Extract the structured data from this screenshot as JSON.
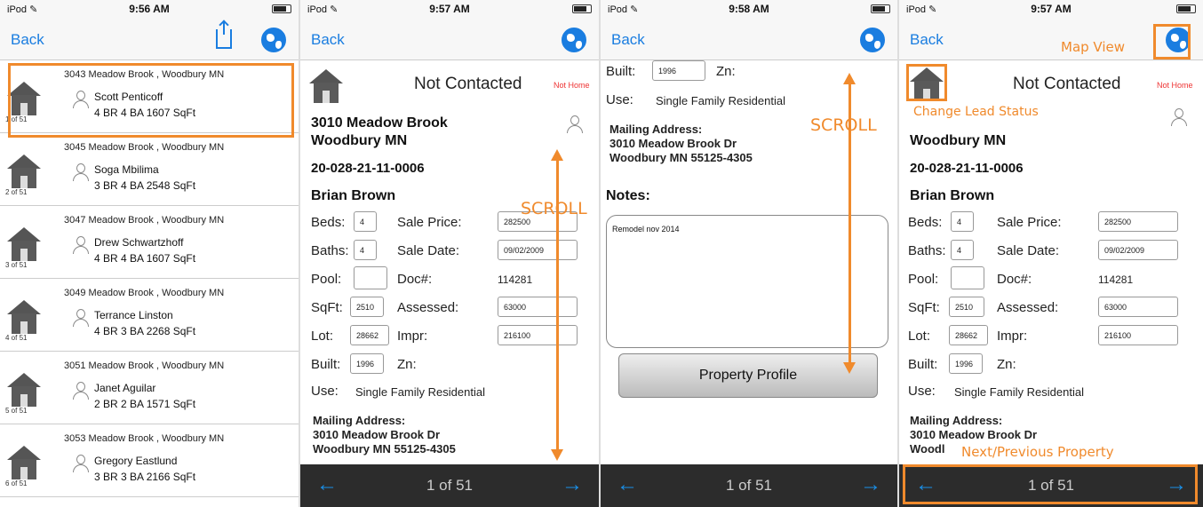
{
  "status_bar": [
    {
      "device": "iPod ✎",
      "time": "9:56 AM"
    },
    {
      "device": "iPod ✎",
      "time": "9:57 AM"
    },
    {
      "device": "iPod ✎",
      "time": "9:58 AM"
    },
    {
      "device": "iPod ✎",
      "time": "9:57 AM"
    }
  ],
  "back_label": "Back",
  "list": [
    {
      "address": "3043 Meadow Brook , Woodbury MN",
      "name": "Scott Penticoff",
      "specs": "4 BR  4 BA  1607 SqFt",
      "count": "1 of 51"
    },
    {
      "address": "3045 Meadow Brook , Woodbury MN",
      "name": "Soga Mbilima",
      "specs": "3 BR  4 BA  2548 SqFt",
      "count": "2 of 51"
    },
    {
      "address": "3047 Meadow Brook , Woodbury MN",
      "name": "Drew Schwartzhoff",
      "specs": "4 BR  4 BA  1607 SqFt",
      "count": "3 of 51"
    },
    {
      "address": "3049 Meadow Brook , Woodbury MN",
      "name": "Terrance Linston",
      "specs": "4 BR  3 BA  2268 SqFt",
      "count": "4 of 51"
    },
    {
      "address": "3051 Meadow Brook , Woodbury MN",
      "name": "Janet Aguilar",
      "specs": "2 BR  2 BA  1571 SqFt",
      "count": "5 of 51"
    },
    {
      "address": "3053 Meadow Brook , Woodbury MN",
      "name": "Gregory Eastlund",
      "specs": "3 BR  3 BA  2166 SqFt",
      "count": "6 of 51"
    }
  ],
  "detail": {
    "status": "Not Contacted",
    "not_home": "Not Home",
    "address_line1": "3010 Meadow Brook",
    "address_line2": "Woodbury MN",
    "parcel": "20-028-21-11-0006",
    "owner": "Brian Brown",
    "beds_label": "Beds:",
    "beds": "4",
    "baths_label": "Baths:",
    "baths": "4",
    "pool_label": "Pool:",
    "pool": "",
    "sqft_label": "SqFt:",
    "sqft": "2510",
    "lot_label": "Lot:",
    "lot": "28662",
    "built_label": "Built:",
    "built": "1996",
    "use_label": "Use:",
    "use": "Single Family Residential",
    "sale_price_label": "Sale Price:",
    "sale_price": "282500",
    "sale_date_label": "Sale Date:",
    "sale_date": "09/02/2009",
    "doc_label": "Doc#:",
    "doc": "114281",
    "assessed_label": "Assessed:",
    "assessed": "63000",
    "impr_label": "Impr:",
    "impr": "216100",
    "zn_label": "Zn:",
    "mailing_label": "Mailing Address:",
    "mailing_line1": "3010 Meadow Brook Dr",
    "mailing_line2": "Woodbury MN 55125-4305",
    "mailing_line2_cut": "Woodl",
    "notes_label": "Notes:",
    "notes": "Remodel nov 2014",
    "profile_button": "Property Profile",
    "pager": "1 of 51",
    "prev_arrow": "←",
    "next_arrow": "→"
  },
  "annotations": {
    "scroll": "SCROLL",
    "map_view": "Map View",
    "change_lead_status": "Change Lead Status",
    "next_previous": "Next/Previous Property"
  },
  "colors": {
    "accent": "#1a7de0",
    "annotation": "#f08a2c",
    "footer": "#2c2c2c"
  }
}
